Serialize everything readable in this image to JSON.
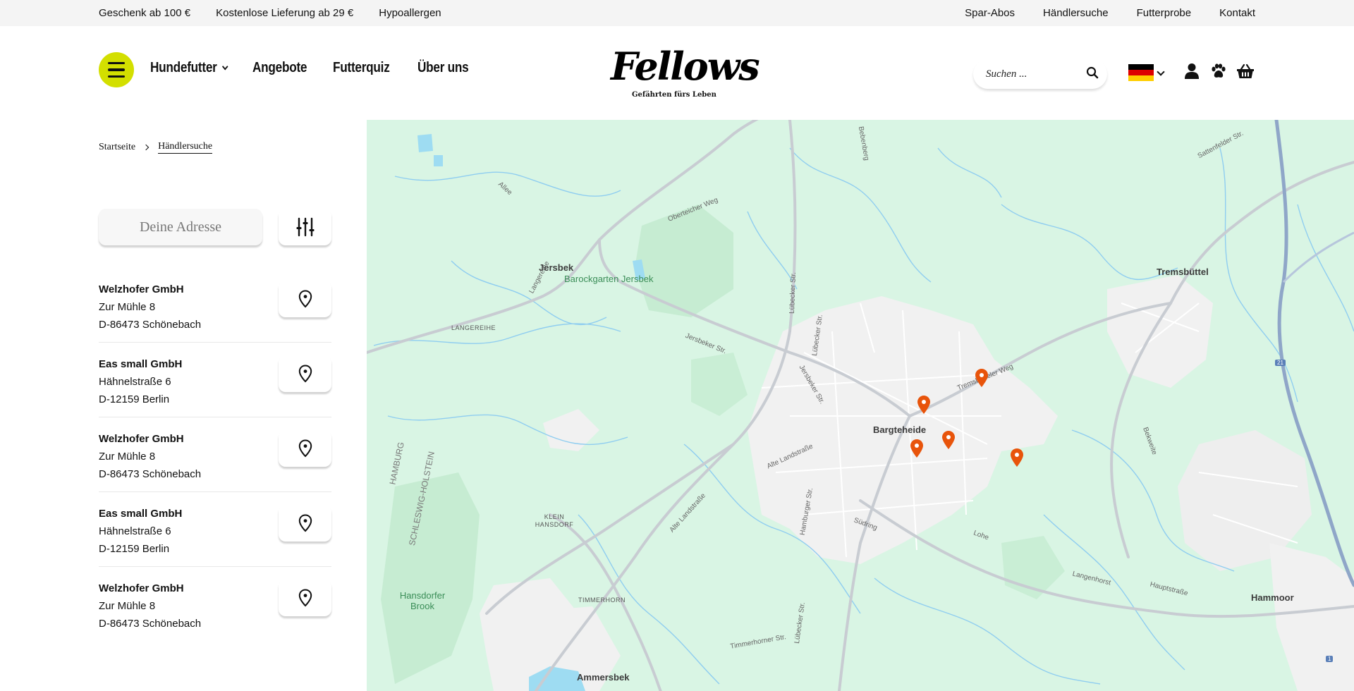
{
  "topbar": {
    "left": [
      "Geschenk ab 100 €",
      "Kostenlose Lieferung ab 29 €",
      "Hypoallergen"
    ],
    "right": [
      "Spar-Abos",
      "Händlersuche",
      "Futterprobe",
      "Kontakt"
    ]
  },
  "nav": {
    "items": [
      "Hundefutter",
      "Angebote",
      "Futterquiz",
      "Über uns"
    ]
  },
  "logo": {
    "wordmark": "Fellows",
    "tagline": "Gefährten fürs Leben"
  },
  "search": {
    "placeholder": "Suchen ..."
  },
  "colors": {
    "accent": "#d3df00",
    "marker": "#e8540b",
    "map_bg": "#d9f5e4"
  },
  "icons": [
    "menu-icon",
    "search-icon",
    "germany-flag-icon",
    "user-icon",
    "paw-icon",
    "basket-icon",
    "filter-sliders-icon",
    "map-pin-icon"
  ],
  "breadcrumb": {
    "home": "Startseite",
    "current": "Händlersuche"
  },
  "address": {
    "placeholder": "Deine Adresse"
  },
  "dealers": [
    {
      "name": "Welzhofer GmbH",
      "street": "Zur Mühle 8",
      "city": "D-86473 Schönebach"
    },
    {
      "name": "Eas small GmbH",
      "street": "Hähnelstraße 6",
      "city": "D-12159 Berlin"
    },
    {
      "name": "Welzhofer GmbH",
      "street": "Zur Mühle 8",
      "city": "D-86473 Schönebach"
    },
    {
      "name": "Eas small GmbH",
      "street": "Hähnelstraße 6",
      "city": "D-12159 Berlin"
    },
    {
      "name": "Welzhofer GmbH",
      "street": "Zur Mühle 8",
      "city": "D-86473 Schönebach"
    }
  ],
  "map": {
    "towns": [
      "Jersbek",
      "Bargteheide",
      "Tremsbüttel",
      "Hammoor",
      "Ammersbek"
    ],
    "parks": [
      "Barockgarten Jersbek",
      "Hansdorfer Brook"
    ],
    "roads": [
      "Allee",
      "Oberteicher Weg",
      "Langereihe",
      "LANGEREIHE",
      "Jersbeker Str.",
      "Lübecker Str.",
      "Tremsbütteler Weg",
      "Alte Landstraße",
      "Hamburger Str.",
      "Südring",
      "Lohe",
      "Langenhorst",
      "Hauptstraße",
      "Timmerhorner Str.",
      "Sattenfelder Str.",
      "Bekweite",
      "Bebenberg"
    ],
    "areas": [
      "KLEIN HANSDORF",
      "TIMMERHORN",
      "HAMBURG",
      "SCHLESWIG-HOLSTEIN"
    ],
    "shields": [
      "21",
      "1"
    ]
  }
}
